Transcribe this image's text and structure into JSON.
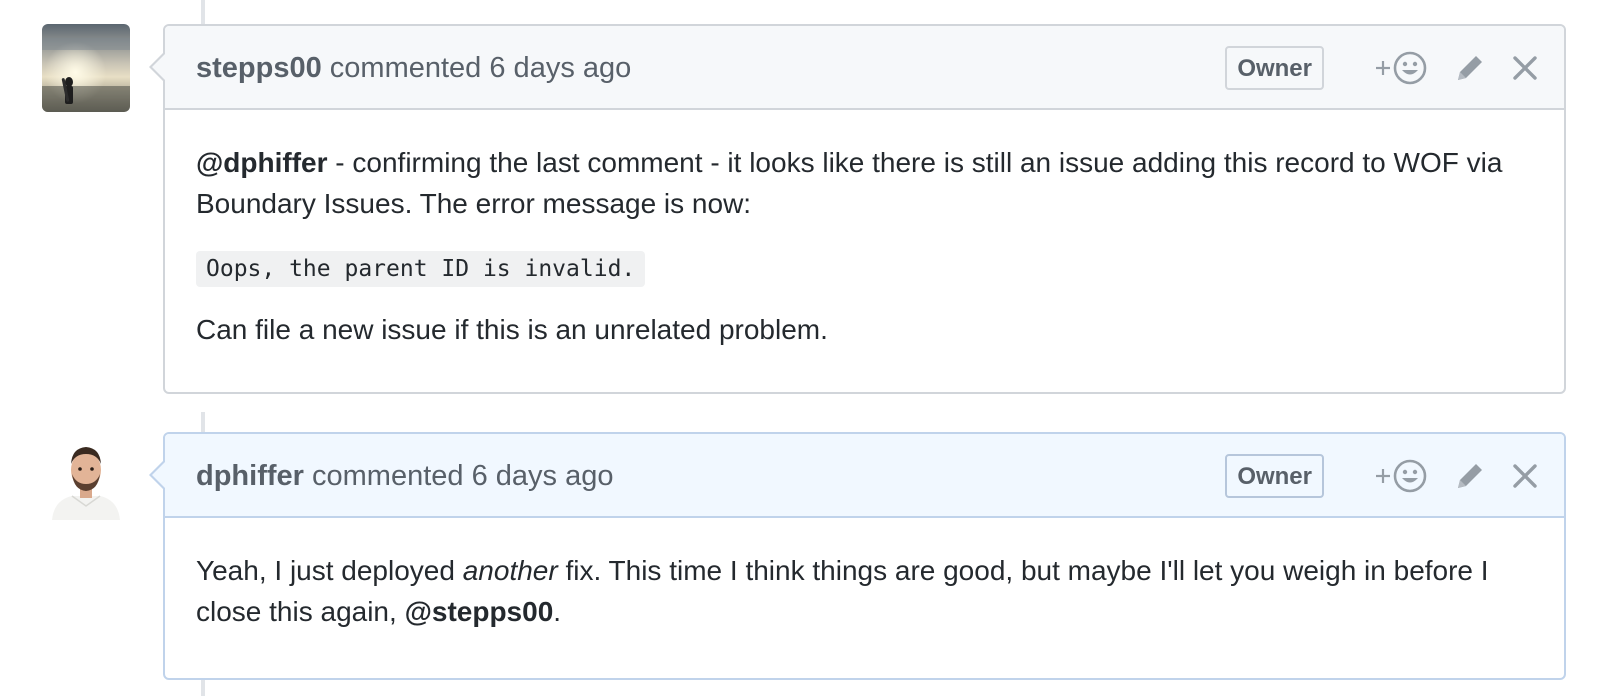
{
  "comments": [
    {
      "author": "stepps00",
      "action": "commented",
      "time": "6 days ago",
      "badge": "Owner",
      "avatar": "surfer-avatar",
      "body": {
        "mention": "@dphiffer",
        "line1_rest": " - confirming the last comment - it looks like there is still an issue adding this record to WOF via Boundary Issues. The error message is now:",
        "code": "Oops, the parent ID is invalid.",
        "line3": "Can file a new issue if this is an unrelated problem."
      }
    },
    {
      "author": "dphiffer",
      "action": "commented",
      "time": "6 days ago",
      "badge": "Owner",
      "avatar": "portrait-avatar",
      "body": {
        "text1": "Yeah, I just deployed ",
        "emphasis": "another",
        "text2": " fix. This time I think things are good, but maybe I'll let you weigh in before I close this again, ",
        "mention": "@stepps00",
        "text3": "."
      }
    }
  ],
  "icons": {
    "reaction": "add-reaction-icon",
    "edit": "pencil-icon",
    "delete": "close-icon"
  },
  "colors": {
    "header_bg": "#f6f8fa",
    "owner_header_bg": "#f1f8ff",
    "border": "#d1d5da",
    "owner_border": "#c0d3eb",
    "muted_text": "#586069"
  }
}
